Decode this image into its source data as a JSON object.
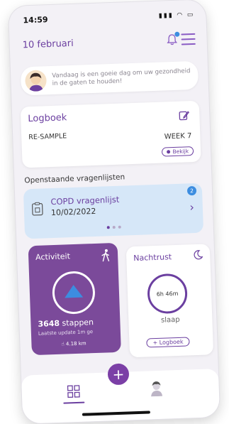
{
  "status_bar": {
    "time": "14:59",
    "icons": "signal wifi battery"
  },
  "header": {
    "date": "10 februari"
  },
  "tip": {
    "text": "Vandaag is een goeie dag om uw gezondheid in de gaten te houden!"
  },
  "logbook": {
    "title": "Logboek",
    "sample": "RE-SAMPLE",
    "week": "WEEK 7",
    "view_label": "Bekijk"
  },
  "open_questionnaires": {
    "section_title": "Openstaande vragenlijsten",
    "count": "2",
    "item_title": "COPD vragenlijst",
    "item_date": "10/02/2022"
  },
  "activity": {
    "title": "Activiteit",
    "steps_value": "3648",
    "steps_unit": "stappen",
    "last_update": "Laatste update 1m ge",
    "distance": "4.18 km"
  },
  "night": {
    "title": "Nachtrust",
    "duration": "6h 46m",
    "label": "slaap",
    "log_button": "+ Logboek"
  },
  "colors": {
    "accent": "#6b3fa0",
    "activity_bg": "#7b4a9a",
    "info_blue": "#3c8de0",
    "quest_bg": "#d6e7f8"
  }
}
